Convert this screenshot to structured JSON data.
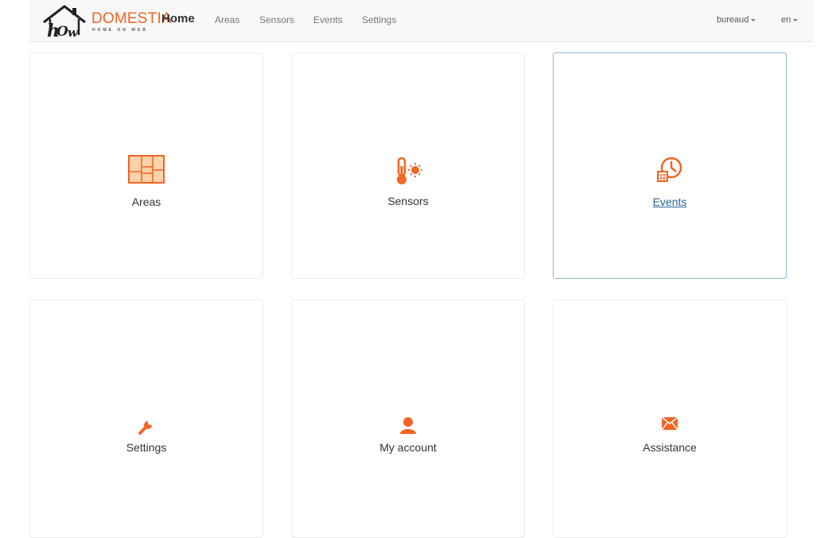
{
  "brand": {
    "name": "DOMESTIA",
    "tagline": "HOME ON WEB",
    "logo_letters": "hOw",
    "home_label": "Home"
  },
  "nav": {
    "links": [
      "Areas",
      "Sensors",
      "Events",
      "Settings"
    ],
    "user_label": "bureaud",
    "lang_label": "en"
  },
  "tiles": [
    {
      "label": "Areas",
      "icon": "floorplan-icon"
    },
    {
      "label": "Sensors",
      "icon": "thermometer-icon"
    },
    {
      "label": "Events",
      "icon": "clock-calendar-icon"
    },
    {
      "label": "Settings",
      "icon": "wrench-icon"
    },
    {
      "label": "My account",
      "icon": "user-icon"
    },
    {
      "label": "Assistance",
      "icon": "envelope-icon"
    }
  ],
  "colors": {
    "accent": "#f26522",
    "link": "#2a6496",
    "navbar_bg": "#f8f8f8"
  }
}
